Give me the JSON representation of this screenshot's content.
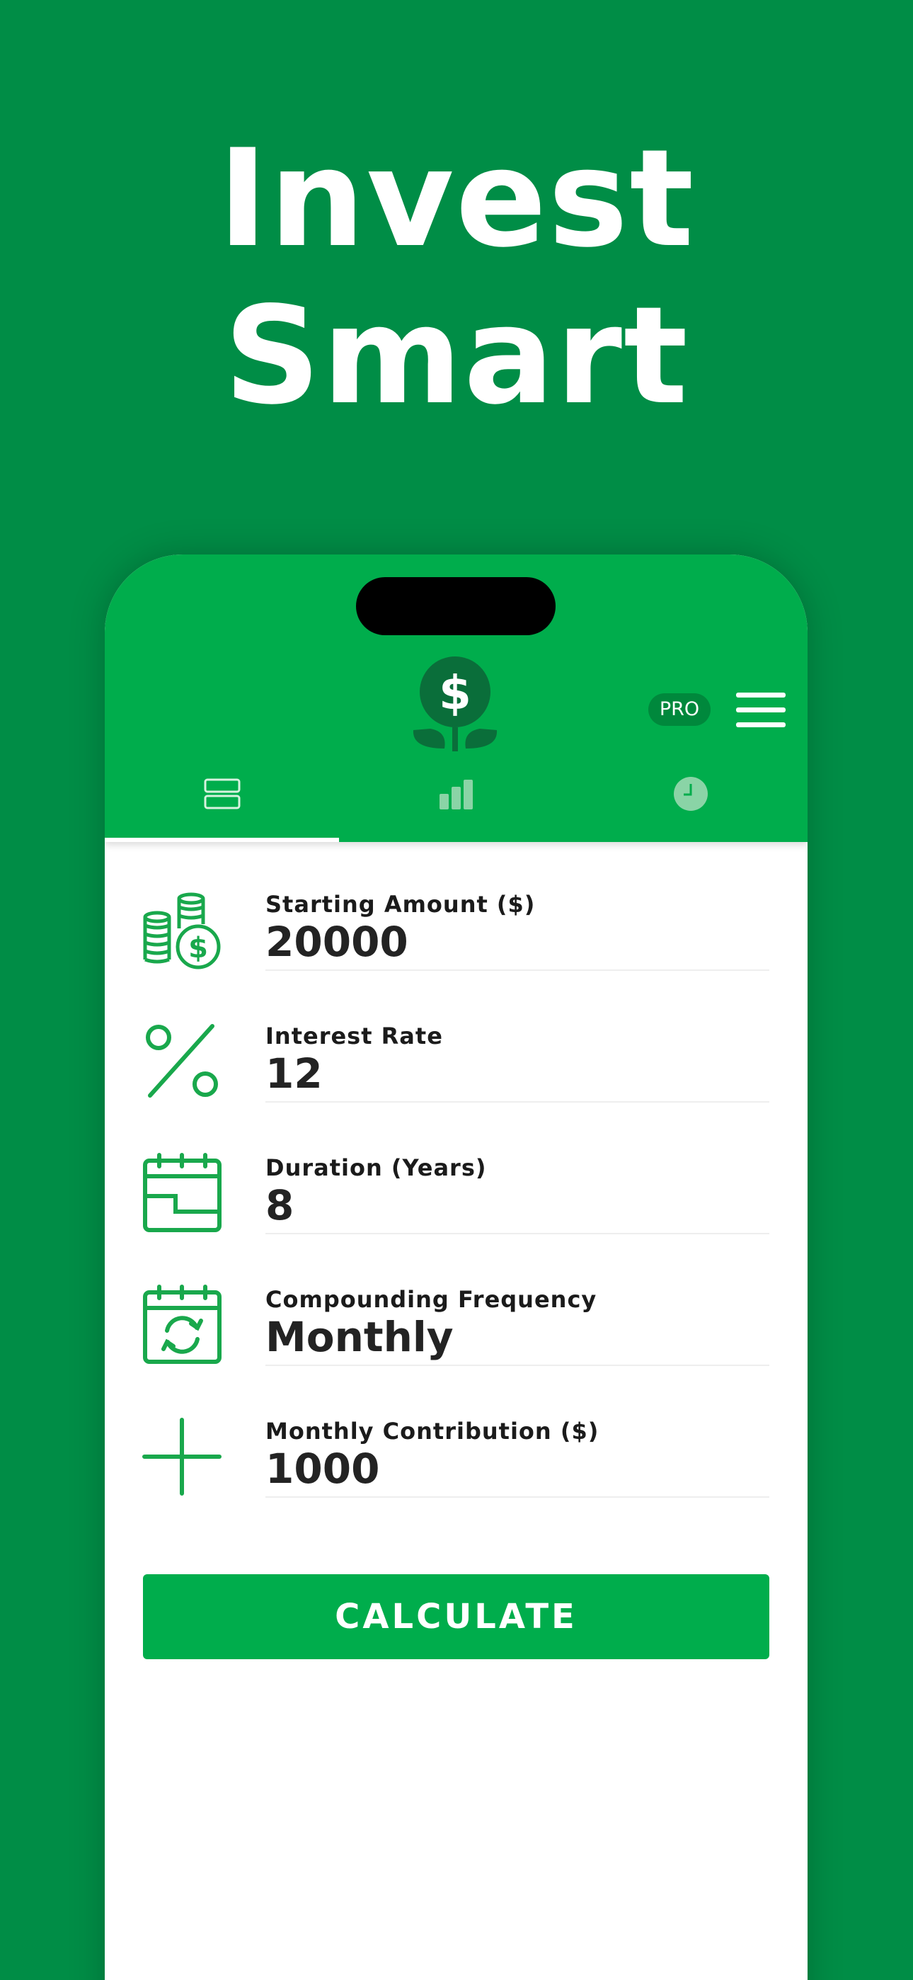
{
  "headline": {
    "line1": "Invest",
    "line2": "Smart"
  },
  "header": {
    "pro_label": "PRO",
    "tabs": [
      {
        "name": "inputs",
        "icon": "stacked-rows-icon",
        "active": true
      },
      {
        "name": "chart",
        "icon": "bar-chart-icon",
        "active": false
      },
      {
        "name": "history",
        "icon": "clock-icon",
        "active": false
      }
    ]
  },
  "form": {
    "fields": [
      {
        "label": "Starting Amount ($)",
        "value": "20000",
        "icon": "coins-dollar-icon"
      },
      {
        "label": "Interest Rate",
        "value": "12",
        "icon": "percent-icon"
      },
      {
        "label": "Duration (Years)",
        "value": "8",
        "icon": "calendar-icon"
      },
      {
        "label": "Compounding Frequency",
        "value": "Monthly",
        "icon": "calendar-refresh-icon"
      },
      {
        "label": "Monthly Contribution ($)",
        "value": "1000",
        "icon": "plus-icon"
      }
    ]
  },
  "calculate_label": "CALCULATE",
  "colors": {
    "background": "#008d46",
    "header_green": "#00ad4c",
    "icon_green": "#19a84c",
    "pro_badge": "#00883c"
  }
}
